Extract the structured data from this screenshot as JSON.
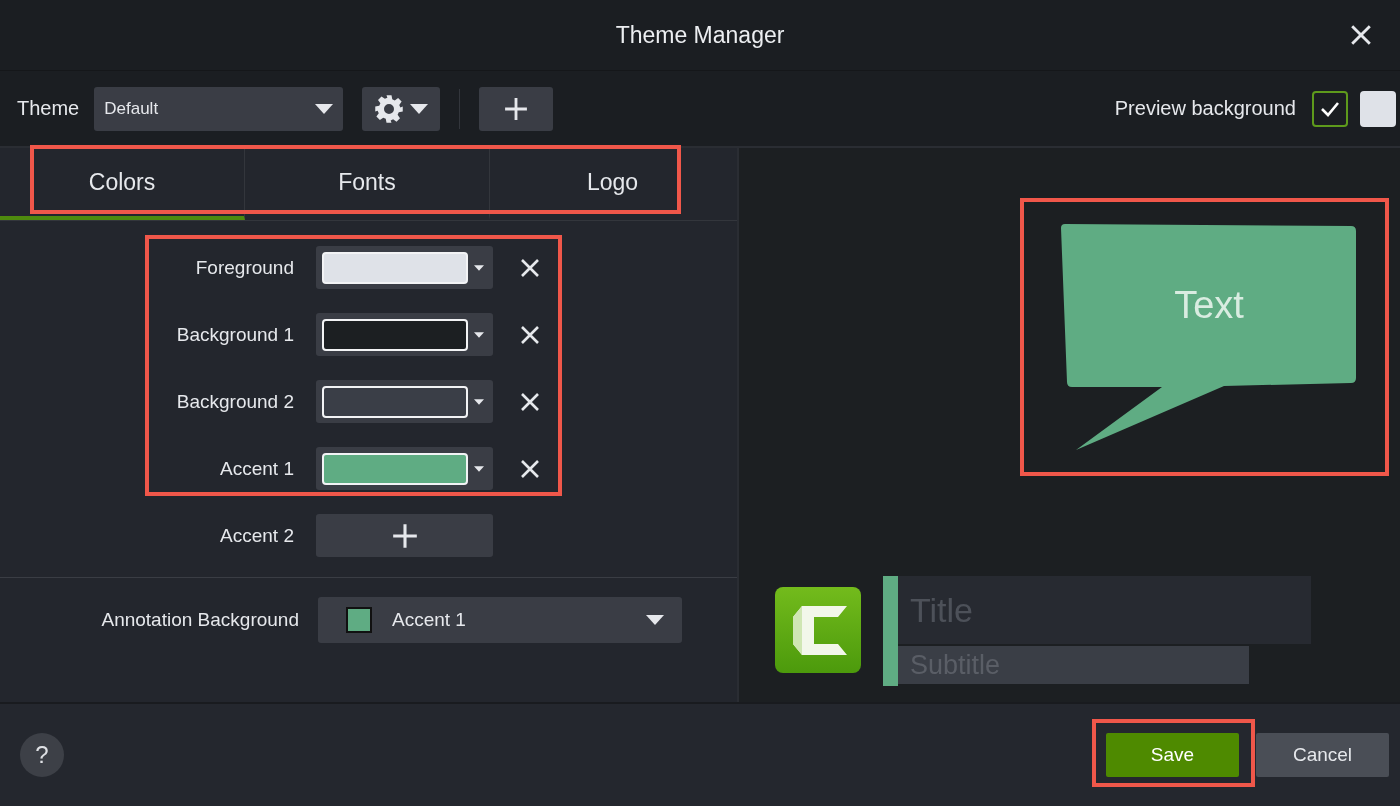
{
  "window": {
    "title": "Theme Manager"
  },
  "toolbar": {
    "theme_label": "Theme",
    "theme_value": "Default",
    "preview_label": "Preview background",
    "preview_options": [
      {
        "kind": "dark",
        "selected": true
      },
      {
        "kind": "light",
        "selected": false
      }
    ]
  },
  "tabs": [
    {
      "label": "Colors",
      "selected": true
    },
    {
      "label": "Fonts",
      "selected": false
    },
    {
      "label": "Logo",
      "selected": false
    }
  ],
  "colors": [
    {
      "label": "Foreground",
      "kind": "swatch",
      "color": "#dfe2e8"
    },
    {
      "label": "Background 1",
      "kind": "swatch",
      "color": "#1c1f22"
    },
    {
      "label": "Background 2",
      "kind": "swatch",
      "color": "#3a3e47"
    },
    {
      "label": "Accent 1",
      "kind": "swatch",
      "color": "#5fac83"
    },
    {
      "label": "Accent 2",
      "kind": "add"
    }
  ],
  "annotation_background": {
    "label": "Annotation Background",
    "value": "Accent 1",
    "color": "#5fac83"
  },
  "preview": {
    "callout_text": "Text",
    "title": "Title",
    "subtitle": "Subtitle"
  },
  "footer": {
    "help": "?",
    "buttons": [
      {
        "label": "Save",
        "kind": "primary"
      },
      {
        "label": "Cancel",
        "kind": "secondary"
      }
    ]
  }
}
